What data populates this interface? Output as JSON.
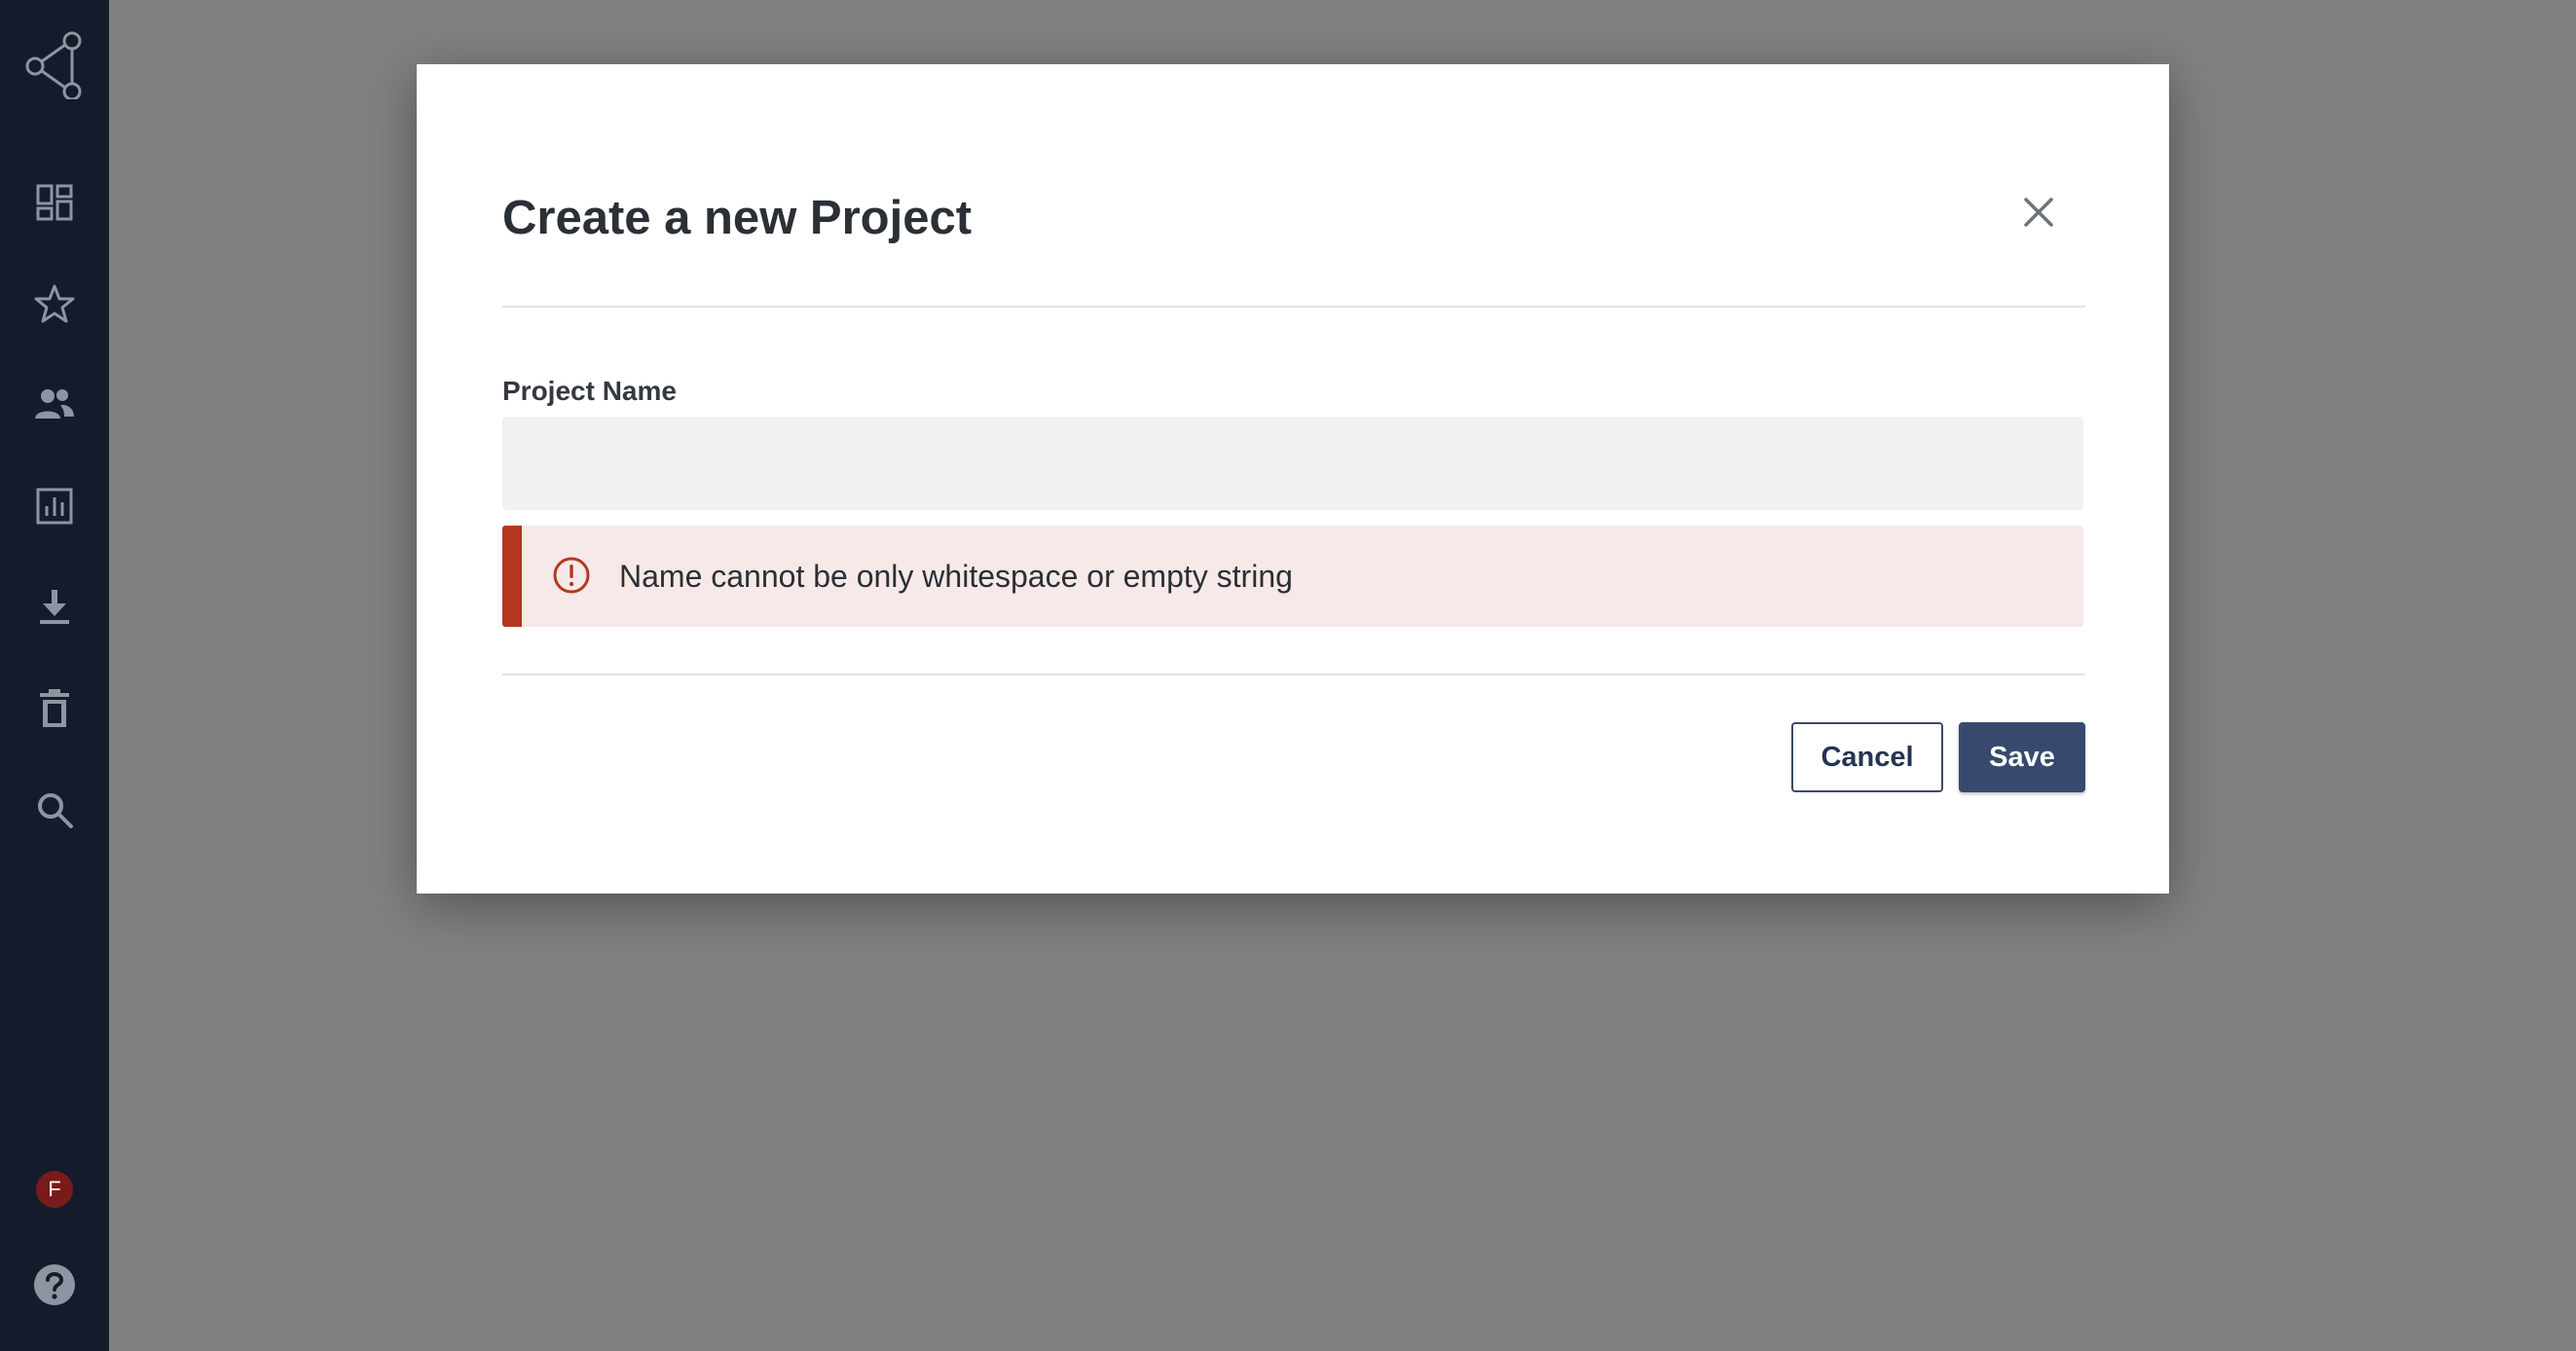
{
  "sidebar": {
    "items": [
      {
        "icon": "dashboard-icon"
      },
      {
        "icon": "star-icon"
      },
      {
        "icon": "users-icon"
      },
      {
        "icon": "bar-chart-icon"
      },
      {
        "icon": "download-icon"
      },
      {
        "icon": "trash-icon"
      },
      {
        "icon": "search-icon"
      }
    ],
    "avatar_initial": "F",
    "help_icon": "help-icon",
    "icon_color": "#8d95a3",
    "background": "#141c2b"
  },
  "modal": {
    "title": "Create a new Project",
    "field_label": "Project Name",
    "input_value": "",
    "input_placeholder": "",
    "error_message": "Name cannot be only whitespace or empty string",
    "cancel_label": "Cancel",
    "save_label": "Save",
    "colors": {
      "error_accent": "#b3381f",
      "error_background": "#f6e9e7",
      "primary": "#374a6e"
    }
  }
}
